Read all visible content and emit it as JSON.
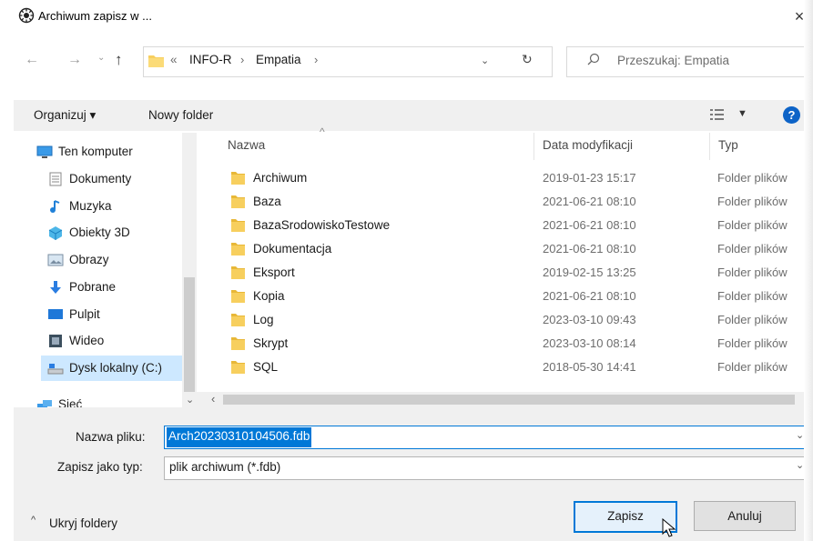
{
  "window": {
    "title": "Archiwum zapisz w ...",
    "close_label": "×"
  },
  "address": {
    "overflow": "«",
    "crumbs": [
      "INFO-R",
      "Empatia"
    ],
    "separator": "›",
    "search_placeholder": "Przeszukaj: Empatia"
  },
  "toolbar": {
    "organize": "Organizuj ▾",
    "new_folder": "Nowy folder",
    "help": "?"
  },
  "nav": {
    "items": [
      {
        "label": "Ten komputer",
        "icon": "computer-icon"
      },
      {
        "label": "Dokumenty",
        "icon": "documents-icon"
      },
      {
        "label": "Muzyka",
        "icon": "music-icon"
      },
      {
        "label": "Obiekty 3D",
        "icon": "3d-objects-icon"
      },
      {
        "label": "Obrazy",
        "icon": "pictures-icon"
      },
      {
        "label": "Pobrane",
        "icon": "downloads-icon"
      },
      {
        "label": "Pulpit",
        "icon": "desktop-icon"
      },
      {
        "label": "Wideo",
        "icon": "video-icon"
      },
      {
        "label": "Dysk lokalny (C:)",
        "icon": "drive-icon"
      },
      {
        "label": "Sieć",
        "icon": "network-icon"
      }
    ],
    "selected": "Dysk lokalny (C:)"
  },
  "files": {
    "columns": {
      "name": "Nazwa",
      "date": "Data modyfikacji",
      "type": "Typ"
    },
    "rows": [
      {
        "name": "Archiwum",
        "date": "2019-01-23 15:17",
        "type": "Folder plików"
      },
      {
        "name": "Baza",
        "date": "2021-06-21 08:10",
        "type": "Folder plików"
      },
      {
        "name": "BazaSrodowiskoTestowe",
        "date": "2021-06-21 08:10",
        "type": "Folder plików"
      },
      {
        "name": "Dokumentacja",
        "date": "2021-06-21 08:10",
        "type": "Folder plików"
      },
      {
        "name": "Eksport",
        "date": "2019-02-15 13:25",
        "type": "Folder plików"
      },
      {
        "name": "Kopia",
        "date": "2021-06-21 08:10",
        "type": "Folder plików"
      },
      {
        "name": "Log",
        "date": "2023-03-10 09:43",
        "type": "Folder plików"
      },
      {
        "name": "Skrypt",
        "date": "2023-03-10 08:14",
        "type": "Folder plików"
      },
      {
        "name": "SQL",
        "date": "2018-05-30 14:41",
        "type": "Folder plików"
      }
    ]
  },
  "save": {
    "filename_label": "Nazwa pliku:",
    "filename_value": "Arch20230310104506.fdb",
    "type_label": "Zapisz jako typ:",
    "type_value": "plik archiwum (*.fdb)",
    "hide_folders": "Ukryj foldery",
    "save_button": "Zapisz",
    "cancel_button": "Anuluj"
  },
  "colors": {
    "accent": "#0078d7",
    "folder": "#f7cf5e",
    "selected_bg": "#cde8ff"
  }
}
